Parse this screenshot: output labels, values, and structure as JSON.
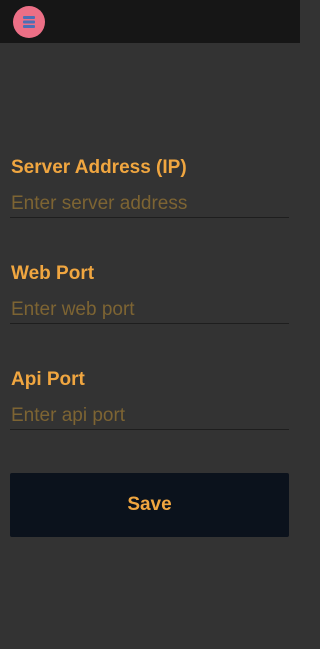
{
  "header": {
    "menu_icon": "stack-icon",
    "menu_color": "#ec6f86"
  },
  "form": {
    "server_address": {
      "label": "Server Address (IP)",
      "placeholder": "Enter server address",
      "value": ""
    },
    "web_port": {
      "label": "Web Port",
      "placeholder": "Enter web port",
      "value": ""
    },
    "api_port": {
      "label": "Api Port",
      "placeholder": "Enter api port",
      "value": ""
    },
    "save_label": "Save"
  },
  "colors": {
    "background": "#333333",
    "topbar": "#161616",
    "accent": "#f0a640",
    "button_bg": "#0b121c"
  }
}
